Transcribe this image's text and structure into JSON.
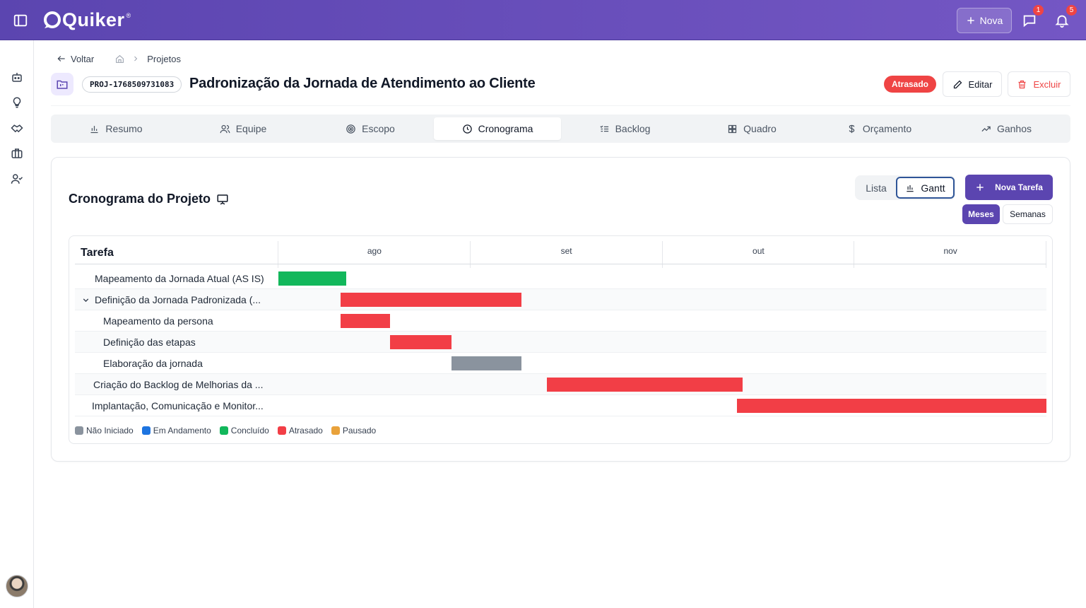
{
  "app": {
    "brand": "Quiker",
    "brand_mark": "®",
    "new_button_label": "Nova",
    "messages_badge": "1",
    "notifications_badge": "5",
    "accent_color": "#5b45b0"
  },
  "sidebar": {
    "items": [
      {
        "icon": "bot-icon"
      },
      {
        "icon": "lightbulb-icon"
      },
      {
        "icon": "handshake-icon"
      },
      {
        "icon": "briefcase-icon"
      },
      {
        "icon": "user-check-icon"
      }
    ]
  },
  "breadcrumb": {
    "back_label": "Voltar",
    "home_icon": "home-icon",
    "current": "Projetos"
  },
  "project": {
    "code": "PROJ-1768509731083",
    "title": "Padronização da Jornada de Atendimento ao Cliente",
    "status": "Atrasado",
    "status_color": "#ef4444",
    "edit_label": "Editar",
    "delete_label": "Excluir"
  },
  "tabs": [
    {
      "label": "Resumo",
      "icon": "bar-chart-icon"
    },
    {
      "label": "Equipe",
      "icon": "users-icon"
    },
    {
      "label": "Escopo",
      "icon": "target-icon"
    },
    {
      "label": "Cronograma",
      "icon": "clock-icon",
      "active": true
    },
    {
      "label": "Backlog",
      "icon": "list-checks-icon"
    },
    {
      "label": "Quadro",
      "icon": "grid-icon"
    },
    {
      "label": "Orçamento",
      "icon": "dollar-icon"
    },
    {
      "label": "Ganhos",
      "icon": "trending-up-icon"
    }
  ],
  "schedule": {
    "title": "Cronograma do Projeto",
    "view_list_label": "Lista",
    "view_gantt_label": "Gantt",
    "new_task_label": "Nova Tarefa",
    "scale_months_label": "Meses",
    "scale_weeks_label": "Semanas",
    "task_column_label": "Tarefa",
    "months": [
      "ago",
      "set",
      "out",
      "nov"
    ],
    "month_days": [
      31,
      30,
      31,
      30
    ],
    "tasks": [
      {
        "label": "Mapeamento da Jornada Atual (AS IS)",
        "level": 0,
        "start": "08-01",
        "end": "08-11",
        "status": "Concluído"
      },
      {
        "label": "Definição da Jornada Padronizada (...",
        "level": 0,
        "collapsible": true,
        "start": "08-11",
        "end": "09-08",
        "status": "Atrasado"
      },
      {
        "label": "Mapeamento da persona",
        "level": 1,
        "start": "08-11",
        "end": "08-18",
        "status": "Atrasado"
      },
      {
        "label": "Definição das etapas",
        "level": 1,
        "start": "08-19",
        "end": "08-28",
        "status": "Atrasado"
      },
      {
        "label": "Elaboração da jornada",
        "level": 1,
        "start": "08-29",
        "end": "09-08",
        "status": "Não Iniciado"
      },
      {
        "label": "Criação do Backlog de Melhorias da ...",
        "level": 0,
        "start": "09-13",
        "end": "10-13",
        "status": "Atrasado"
      },
      {
        "label": "Implantação, Comunicação e Monitor...",
        "level": 0,
        "start": "10-13",
        "end": "11-30",
        "status": "Atrasado"
      }
    ],
    "legend": [
      {
        "label": "Não Iniciado",
        "color": "#8a939e"
      },
      {
        "label": "Em Andamento",
        "color": "#1d74e0"
      },
      {
        "label": "Concluído",
        "color": "#12b75b"
      },
      {
        "label": "Atrasado",
        "color": "#f23e46"
      },
      {
        "label": "Pausado",
        "color": "#e9a23b"
      }
    ]
  }
}
